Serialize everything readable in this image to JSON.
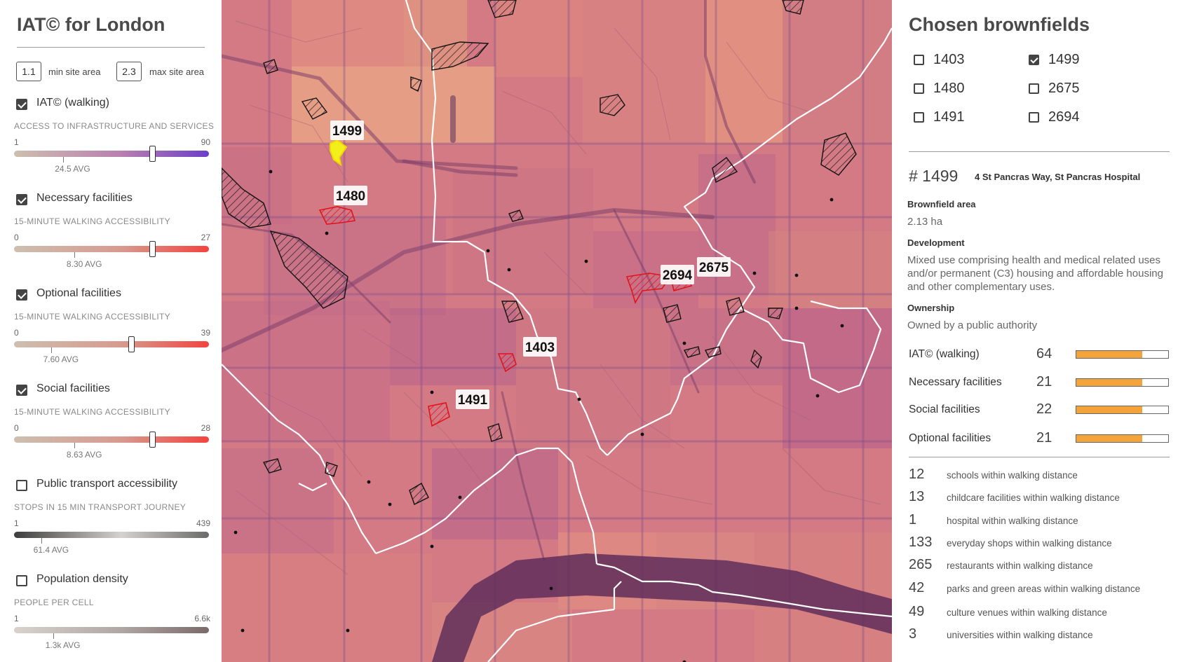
{
  "app": {
    "title": "IAT© for London"
  },
  "filters": {
    "min_value": "1.1",
    "min_label": "min site area",
    "max_value": "2.3",
    "max_label": "max site area"
  },
  "layers": [
    {
      "name": "IAT© (walking)",
      "checked": true,
      "subtitle": "ACCESS TO INFRASTRUCTURE AND SERVICES",
      "range_min": "1",
      "range_max": "90",
      "avg": "24.5 AVG",
      "gradient": [
        "#cdbfaf",
        "#b97fb0",
        "#6b3fc9"
      ]
    },
    {
      "name": "Necessary facilities",
      "checked": true,
      "subtitle": "15-MINUTE WALKING ACCESSIBILITY",
      "range_min": "0",
      "range_max": "27",
      "avg": "8.30 AVG",
      "gradient": [
        "#cdbfaf",
        "#d79a8f",
        "#f2443f"
      ]
    },
    {
      "name": "Optional facilities",
      "checked": true,
      "subtitle": "15-MINUTE WALKING ACCESSIBILITY",
      "range_min": "0",
      "range_max": "39",
      "avg": "7.60 AVG",
      "gradient": [
        "#cdbfaf",
        "#d79a8f",
        "#f2443f"
      ]
    },
    {
      "name": "Social facilities",
      "checked": true,
      "subtitle": "15-MINUTE WALKING ACCESSIBILITY",
      "range_min": "0",
      "range_max": "28",
      "avg": "8.63 AVG",
      "gradient": [
        "#cdbfaf",
        "#d79a8f",
        "#f2443f"
      ]
    },
    {
      "name": "Public transport accessibility",
      "checked": false,
      "subtitle": "STOPS IN 15 MIN TRANSPORT JOURNEY",
      "range_min": "1",
      "range_max": "439",
      "avg": "61.4 AVG",
      "gradient": [
        "#3d3d3d",
        "#d4d2cf",
        "#6a6a6a"
      ]
    },
    {
      "name": "Population density",
      "checked": false,
      "subtitle": "PEOPLE PER CELL",
      "range_min": "1",
      "range_max": "6.6k",
      "avg": "1.3k AVG",
      "gradient": [
        "#d9d2cc",
        "#b0a6a4",
        "#7a6a6a"
      ]
    }
  ],
  "map": {
    "site_labels": [
      "1499",
      "1480",
      "2694",
      "2675",
      "1403",
      "1491"
    ]
  },
  "brownfields": {
    "title": "Chosen brownfields",
    "items": [
      {
        "id": "1403",
        "checked": false
      },
      {
        "id": "1499",
        "checked": true
      },
      {
        "id": "1480",
        "checked": false
      },
      {
        "id": "2675",
        "checked": false
      },
      {
        "id": "1491",
        "checked": false
      },
      {
        "id": "2694",
        "checked": false
      }
    ]
  },
  "detail": {
    "site_number": "# 1499",
    "address": "4 St Pancras Way, St Pancras Hospital",
    "area_heading": "Brownfield area",
    "area_value": "2.13 ha",
    "development_heading": "Development",
    "development_text": "Mixed use comprising health and medical related uses and/or permanent (C3) housing and affordable housing and other complementary uses.",
    "ownership_heading": "Ownership",
    "ownership_text": "Owned by a public authority",
    "metrics": [
      {
        "name": "IAT© (walking)",
        "value": "64",
        "fill": 0.72
      },
      {
        "name": "Necessary facilities",
        "value": "21",
        "fill": 0.72
      },
      {
        "name": "Social facilities",
        "value": "22",
        "fill": 0.72
      },
      {
        "name": "Optional facilities",
        "value": "21",
        "fill": 0.72
      }
    ],
    "bar_color": "#f3a33a",
    "counts": [
      {
        "value": "12",
        "label": "schools within walking distance"
      },
      {
        "value": "13",
        "label": "childcare facilities within walking distance"
      },
      {
        "value": "1",
        "label": "hospital within walking distance"
      },
      {
        "value": "133",
        "label": "everyday shops within walking distance"
      },
      {
        "value": "265",
        "label": "restaurants within walking distance"
      },
      {
        "value": "42",
        "label": "parks and green areas within walking distance"
      },
      {
        "value": "49",
        "label": "culture venues within walking distance"
      },
      {
        "value": "3",
        "label": "universities within walking distance"
      }
    ]
  }
}
